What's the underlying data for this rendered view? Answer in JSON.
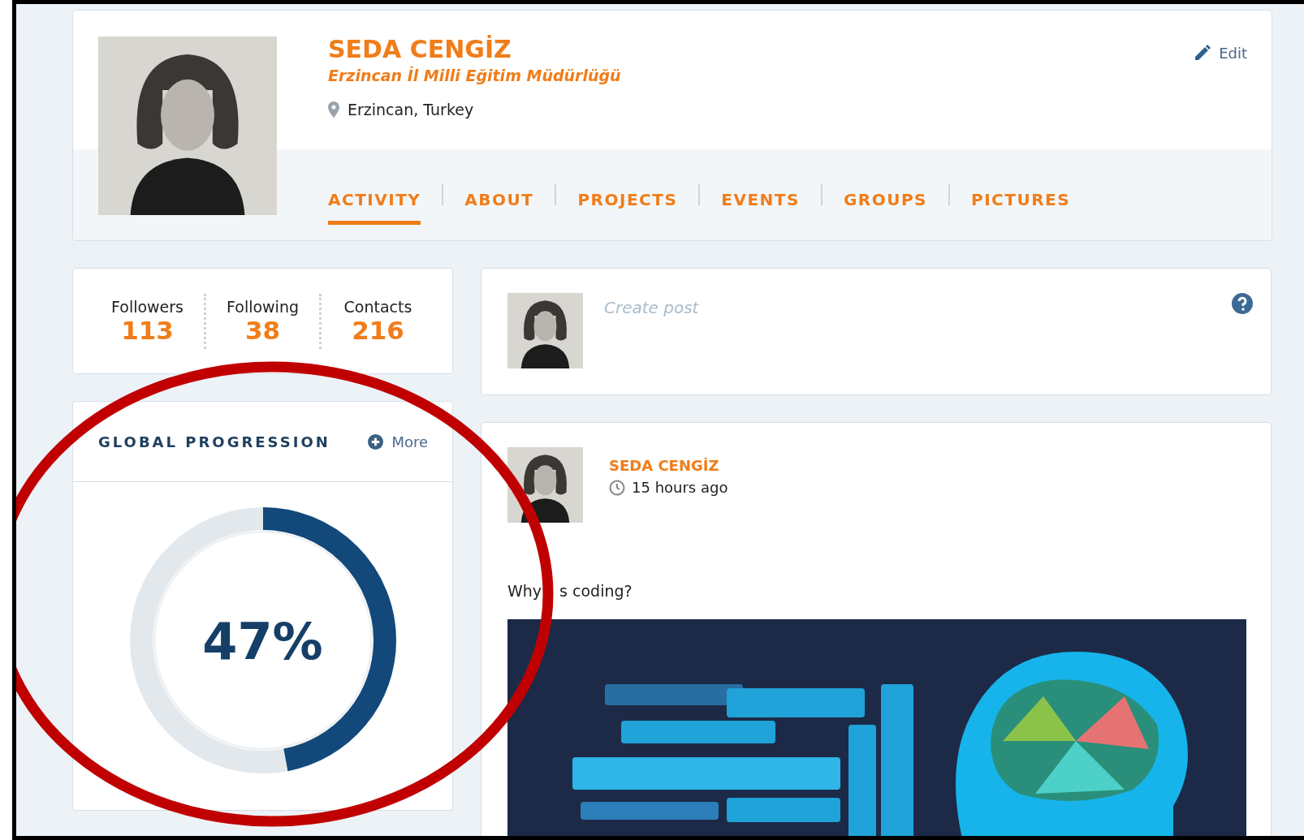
{
  "profile": {
    "name": "SEDA CENGİZ",
    "organization": "Erzincan İl Milli Eğitim Müdürlüğü",
    "location": "Erzincan, Turkey",
    "edit": "Edit"
  },
  "tabs": [
    {
      "label": "ACTIVITY",
      "selected": true
    },
    {
      "label": "ABOUT",
      "selected": false
    },
    {
      "label": "PROJECTS",
      "selected": false
    },
    {
      "label": "EVENTS",
      "selected": false
    },
    {
      "label": "GROUPS",
      "selected": false
    },
    {
      "label": "PICTURES",
      "selected": false
    }
  ],
  "stats": [
    {
      "label": "Followers",
      "value": "113"
    },
    {
      "label": "Following",
      "value": "38"
    },
    {
      "label": "Contacts",
      "value": "216"
    }
  ],
  "progression": {
    "title": "GLOBAL PROGRESSION",
    "more": "More",
    "level": 0.47,
    "reading": "47%"
  },
  "create_post": {
    "placeholder": "Create post"
  },
  "post": {
    "author": "SEDA CENGİZ",
    "time": "15 hours ago",
    "text_parts": [
      "Why",
      "s coding?"
    ],
    "image": {
      "kind": "picture"
    }
  }
}
